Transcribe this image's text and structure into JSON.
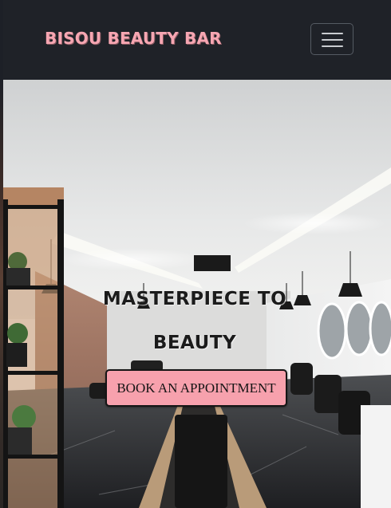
{
  "navbar": {
    "brand": "BISOU BEAUTY BAR",
    "menu_toggle_icon": "hamburger-menu-icon"
  },
  "hero": {
    "title_line1": "MASTERPIECE TO",
    "title_line2": "BEAUTY",
    "cta_label": "BOOK AN APPOINTMENT"
  },
  "colors": {
    "navbar_bg": "#1f2228",
    "brand_pink": "#f6a6b2",
    "button_pink": "#f7a1ad",
    "toggler_icon": "#c9ccd0"
  }
}
